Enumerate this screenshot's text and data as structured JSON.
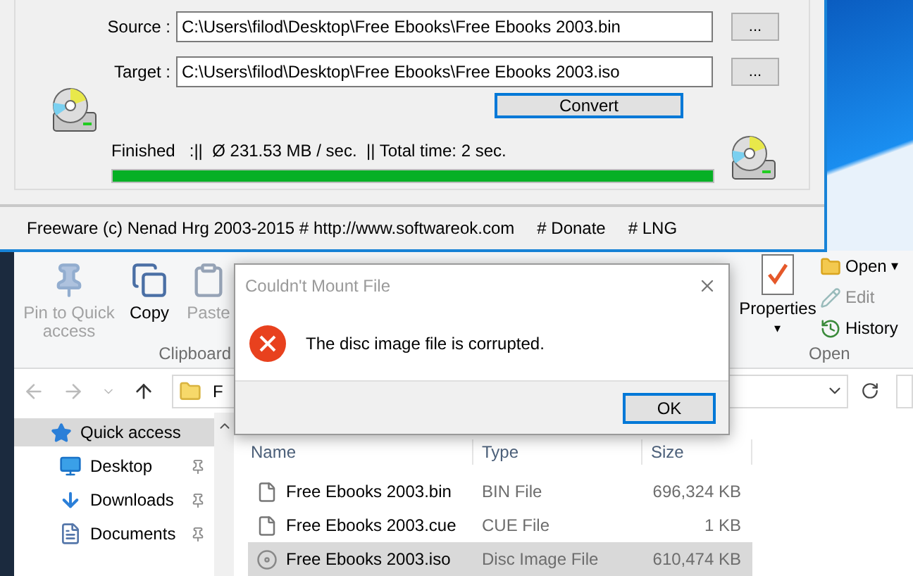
{
  "converter": {
    "source_label": "Source :",
    "source_value": "C:\\Users\\filod\\Desktop\\Free Ebooks\\Free Ebooks 2003.bin",
    "source_browse": "...",
    "target_label": "Target :",
    "target_value": "C:\\Users\\filod\\Desktop\\Free Ebooks\\Free Ebooks 2003.iso",
    "target_browse": "...",
    "convert_button": "Convert",
    "status": "Finished   :||  Ø 231.53 MB / sec.  || Total time: 2 sec.",
    "progress": {
      "level": 1
    },
    "footer": [
      "Freeware (c) Nenad Hrg 2003-2015 # http://www.softwareok.com",
      "# Donate",
      "# LNG"
    ]
  },
  "explorer": {
    "clipboard": {
      "buttons": [
        {
          "kind": "pin",
          "label": "Pin to Quick access",
          "disabled": true
        },
        {
          "kind": "copy",
          "label": "Copy",
          "disabled": false
        },
        {
          "kind": "paste",
          "label": "Paste",
          "disabled": true
        }
      ],
      "group": "Clipboard"
    },
    "open_group": {
      "properties": {
        "label": "Properties",
        "caret": "▾"
      },
      "items": [
        {
          "kind": "open",
          "label": "Open",
          "caret": "▾",
          "disabled": false
        },
        {
          "kind": "edit",
          "label": "Edit",
          "disabled": true
        },
        {
          "kind": "history",
          "label": "History",
          "disabled": false
        }
      ],
      "group": "Open"
    },
    "address": {
      "path": "F"
    },
    "nav": [
      {
        "kind": "star",
        "label": "Quick access",
        "selected": true,
        "pinned": false
      },
      {
        "kind": "desktop",
        "label": "Desktop",
        "selected": false,
        "pinned": true
      },
      {
        "kind": "downloads",
        "label": "Downloads",
        "selected": false,
        "pinned": true
      },
      {
        "kind": "documents",
        "label": "Documents",
        "selected": false,
        "pinned": true
      }
    ],
    "columns": [
      "Name",
      "Type",
      "Size"
    ],
    "files": [
      {
        "kind": "file",
        "name": "Free Ebooks 2003.bin",
        "type": "BIN File",
        "size": "696,324 KB",
        "selected": false
      },
      {
        "kind": "file",
        "name": "Free Ebooks 2003.cue",
        "type": "CUE File",
        "size": "1 KB",
        "selected": false
      },
      {
        "kind": "disc",
        "name": "Free Ebooks 2003.iso",
        "type": "Disc Image File",
        "size": "610,474 KB",
        "selected": true
      }
    ]
  },
  "dialog": {
    "title": "Couldn't Mount File",
    "message": "The disc image file is corrupted.",
    "ok": "OK"
  }
}
